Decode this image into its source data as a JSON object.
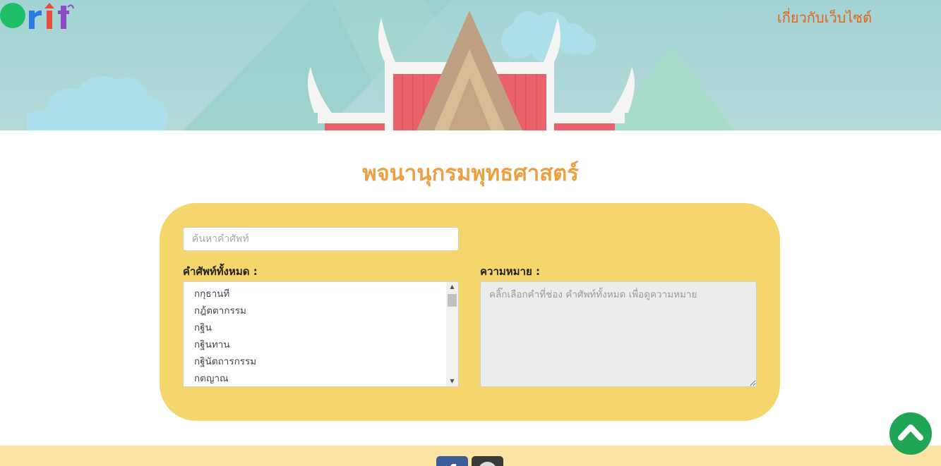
{
  "header": {
    "about_link": "เกี่ยวกับเว็บไซต์"
  },
  "main": {
    "title": "พจนานุกรมพุทธศาสตร์",
    "search_placeholder": "ค้นหาคำศัพท์",
    "words_label": "คำศัพท์ทั้งหมด :",
    "meaning_label": "ความหมาย :",
    "meaning_placeholder": "คลิ๊กเลือกคำที่ช่อง คำศัพท์ทั้งหมด เพื่อดูความหมาย",
    "words": [
      "กกุธานที",
      "กฎ้ตตากรรม",
      "กฐิน",
      "กฐินทาน",
      "กฐินัตถารกรรม",
      "กตญาณ"
    ]
  },
  "footer": {
    "facebook_icon": "facebook-icon",
    "share_icon": "share-icon"
  },
  "colors": {
    "accent_orange": "#e2651c",
    "title_orange": "#eba043",
    "card_yellow": "#f5d66d",
    "footer_cream": "#fce3a6",
    "top_button_green": "#1fa654"
  }
}
